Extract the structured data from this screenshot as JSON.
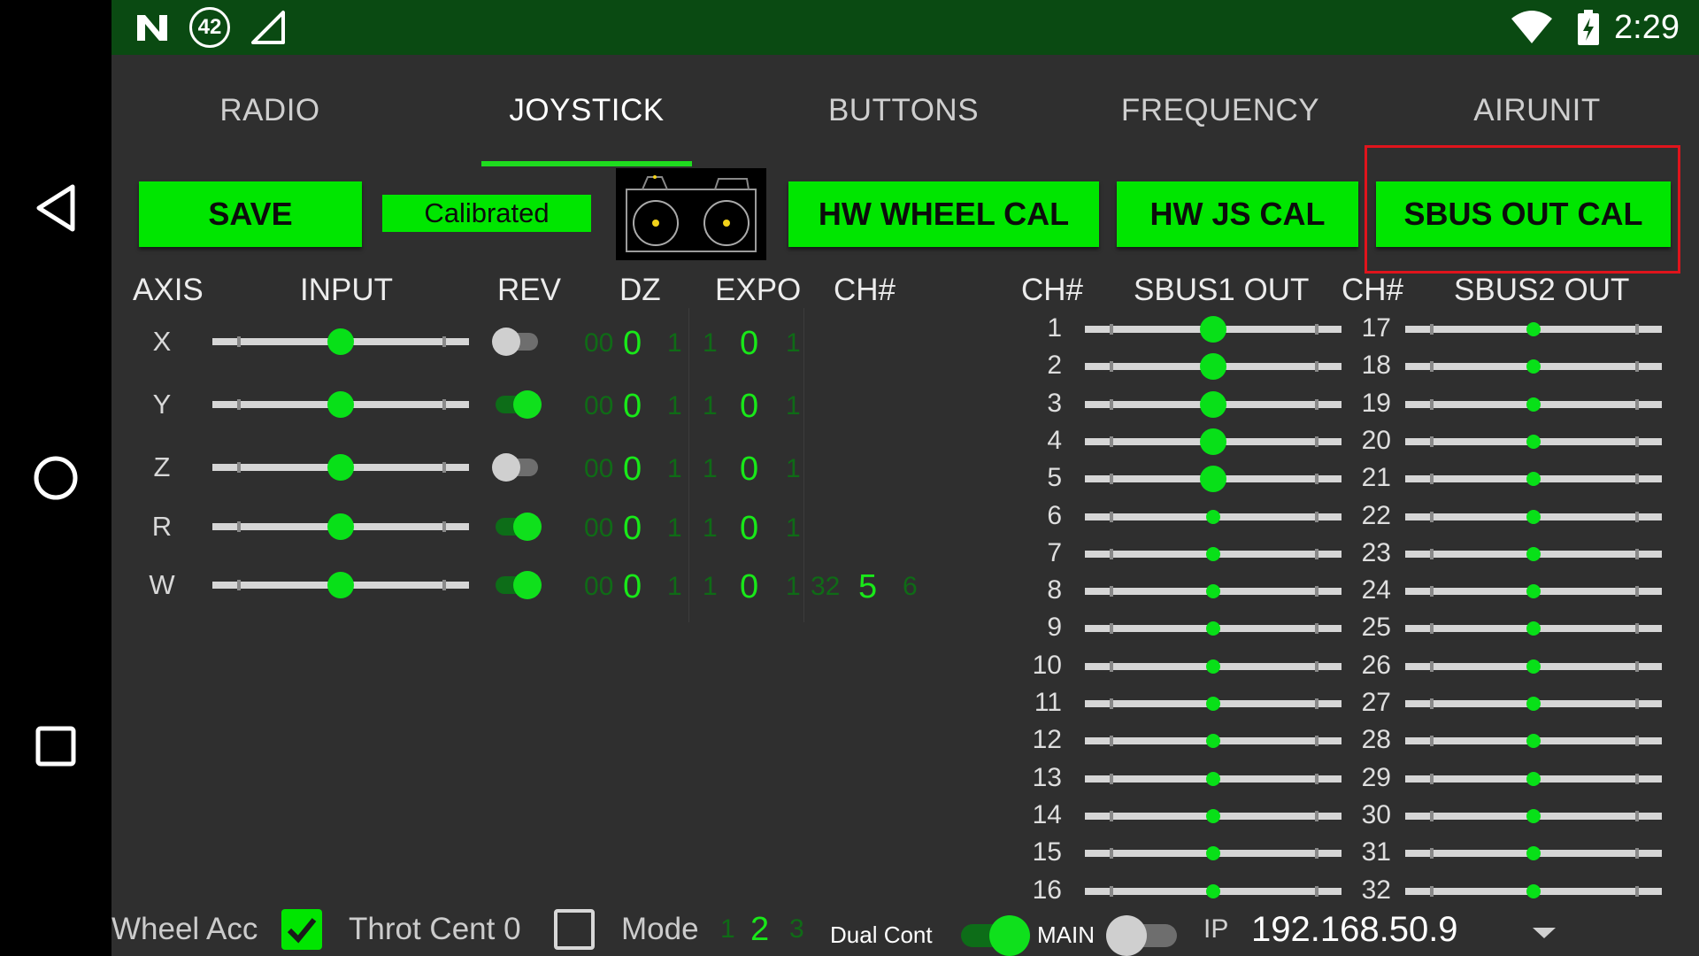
{
  "status_bar": {
    "time": "2:29",
    "notification_badge": "42",
    "icons": [
      "n-logo-icon",
      "notification-badge-icon",
      "signal-icon",
      "wifi-icon",
      "battery-charging-icon"
    ]
  },
  "tabs": [
    {
      "label": "RADIO",
      "active": false
    },
    {
      "label": "JOYSTICK",
      "active": true
    },
    {
      "label": "BUTTONS",
      "active": false
    },
    {
      "label": "FREQUENCY",
      "active": false
    },
    {
      "label": "AIRUNIT",
      "active": false
    }
  ],
  "buttons": {
    "save": "SAVE",
    "calibrated": "Calibrated",
    "hw_wheel_cal": "HW WHEEL CAL",
    "hw_js_cal": "HW JS CAL",
    "sbus_out_cal": "SBUS OUT CAL"
  },
  "headers": {
    "axis": "AXIS",
    "input": "INPUT",
    "rev": "REV",
    "dz": "DZ",
    "expo": "EXPO",
    "ch": "CH#",
    "ch_left": "CH#",
    "sbus1": "SBUS1 OUT",
    "ch_right": "CH#",
    "sbus2": "SBUS2 OUT"
  },
  "axes": [
    {
      "name": "X",
      "input": 0.5,
      "rev": false,
      "dz_prev": "00",
      "dz": "0",
      "dz_next": "1",
      "expo_prev": "1",
      "expo": "0",
      "expo_next": "1",
      "ch": "",
      "ch_prev": "",
      "ch_next": ""
    },
    {
      "name": "Y",
      "input": 0.5,
      "rev": true,
      "dz_prev": "00",
      "dz": "0",
      "dz_next": "1",
      "expo_prev": "1",
      "expo": "0",
      "expo_next": "1",
      "ch": "",
      "ch_prev": "",
      "ch_next": ""
    },
    {
      "name": "Z",
      "input": 0.5,
      "rev": false,
      "dz_prev": "00",
      "dz": "0",
      "dz_next": "1",
      "expo_prev": "1",
      "expo": "0",
      "expo_next": "1",
      "ch": "",
      "ch_prev": "",
      "ch_next": ""
    },
    {
      "name": "R",
      "input": 0.5,
      "rev": true,
      "dz_prev": "00",
      "dz": "0",
      "dz_next": "1",
      "expo_prev": "1",
      "expo": "0",
      "expo_next": "1",
      "ch": "",
      "ch_prev": "",
      "ch_next": ""
    },
    {
      "name": "W",
      "input": 0.5,
      "rev": true,
      "dz_prev": "00",
      "dz": "0",
      "dz_next": "1",
      "expo_prev": "1",
      "expo": "0",
      "expo_next": "1",
      "ch_prev": "32",
      "ch": "5",
      "ch_next": "6"
    }
  ],
  "sbus1": [
    {
      "ch": "1",
      "value": 0.5,
      "active": true
    },
    {
      "ch": "2",
      "value": 0.5,
      "active": true
    },
    {
      "ch": "3",
      "value": 0.5,
      "active": true
    },
    {
      "ch": "4",
      "value": 0.5,
      "active": true
    },
    {
      "ch": "5",
      "value": 0.5,
      "active": true
    },
    {
      "ch": "6",
      "value": 0.5,
      "active": false
    },
    {
      "ch": "7",
      "value": 0.5,
      "active": false
    },
    {
      "ch": "8",
      "value": 0.5,
      "active": false
    },
    {
      "ch": "9",
      "value": 0.5,
      "active": false
    },
    {
      "ch": "10",
      "value": 0.5,
      "active": false
    },
    {
      "ch": "11",
      "value": 0.5,
      "active": false
    },
    {
      "ch": "12",
      "value": 0.5,
      "active": false
    },
    {
      "ch": "13",
      "value": 0.5,
      "active": false
    },
    {
      "ch": "14",
      "value": 0.5,
      "active": false
    },
    {
      "ch": "15",
      "value": 0.5,
      "active": false
    },
    {
      "ch": "16",
      "value": 0.5,
      "active": false
    }
  ],
  "sbus2": [
    {
      "ch": "17",
      "value": 0.5
    },
    {
      "ch": "18",
      "value": 0.5
    },
    {
      "ch": "19",
      "value": 0.5
    },
    {
      "ch": "20",
      "value": 0.5
    },
    {
      "ch": "21",
      "value": 0.5
    },
    {
      "ch": "22",
      "value": 0.5
    },
    {
      "ch": "23",
      "value": 0.5
    },
    {
      "ch": "24",
      "value": 0.5
    },
    {
      "ch": "25",
      "value": 0.5
    },
    {
      "ch": "26",
      "value": 0.5
    },
    {
      "ch": "27",
      "value": 0.5
    },
    {
      "ch": "28",
      "value": 0.5
    },
    {
      "ch": "29",
      "value": 0.5
    },
    {
      "ch": "30",
      "value": 0.5
    },
    {
      "ch": "31",
      "value": 0.5
    },
    {
      "ch": "32",
      "value": 0.5
    }
  ],
  "bottom": {
    "wheel_acc_label": "Wheel Acc",
    "wheel_acc_checked": true,
    "throt_cent_label": "Throt Cent 0",
    "throt_cent_checked": false,
    "mode_label": "Mode",
    "mode_prev": "1",
    "mode_value": "2",
    "mode_next": "3",
    "dual_cont_label": "Dual Cont",
    "dual_cont_on": true,
    "main_label": "MAIN",
    "main_on": false,
    "ip_label": "IP",
    "ip_value": "192.168.50.9"
  },
  "colors": {
    "accent": "#00e600",
    "statusbar": "#0a4a12",
    "background": "#2f2f2f",
    "highlight": "#e0141c"
  }
}
